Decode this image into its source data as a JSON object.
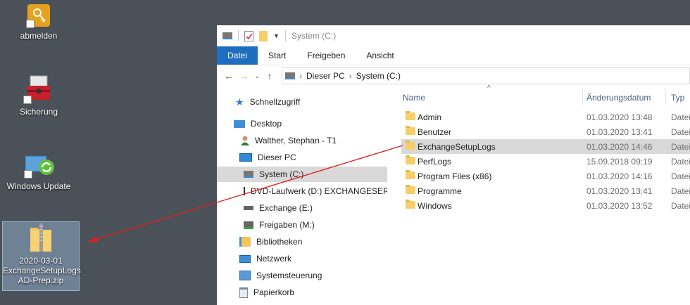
{
  "desktop": {
    "icons": [
      {
        "label": "abmelden"
      },
      {
        "label": "Sicherung"
      },
      {
        "label": "Windows Update"
      }
    ],
    "zip_file": {
      "line1": "2020-03-01",
      "line2": "ExchangeSetupLogs",
      "line3": "AD-Prep.zip"
    }
  },
  "explorer": {
    "title": "System (C:)",
    "ribbon_tabs": [
      "Datei",
      "Start",
      "Freigeben",
      "Ansicht"
    ],
    "breadcrumb": [
      "Dieser PC",
      "System (C:)"
    ],
    "nav": [
      {
        "label": "Schnellzugriff"
      },
      {
        "label": "Desktop"
      },
      {
        "label": "Walther, Stephan - T1"
      },
      {
        "label": "Dieser PC"
      },
      {
        "label": "System (C:)"
      },
      {
        "label": "DVD-Laufwerk (D:) EXCHANGESER"
      },
      {
        "label": "Exchange (E:)"
      },
      {
        "label": "Freigaben (M:)"
      },
      {
        "label": "Bibliotheken"
      },
      {
        "label": "Netzwerk"
      },
      {
        "label": "Systemsteuerung"
      },
      {
        "label": "Papierkorb"
      }
    ],
    "columns": {
      "name": "Name",
      "date": "Änderungsdatum",
      "type": "Typ"
    },
    "files": [
      {
        "name": "Admin",
        "date": "01.03.2020 13:48",
        "type": "Datei"
      },
      {
        "name": "Benutzer",
        "date": "01.03.2020 13:41",
        "type": "Datei"
      },
      {
        "name": "ExchangeSetupLogs",
        "date": "01.03.2020 14:46",
        "type": "Datei"
      },
      {
        "name": "PerfLogs",
        "date": "15.09.2018 09:19",
        "type": "Datei"
      },
      {
        "name": "Program Files (x86)",
        "date": "01.03.2020 14:16",
        "type": "Datei"
      },
      {
        "name": "Programme",
        "date": "01.03.2020 13:41",
        "type": "Datei"
      },
      {
        "name": "Windows",
        "date": "01.03.2020 13:52",
        "type": "Datei"
      }
    ]
  },
  "colors": {
    "accent": "#1e6ebf",
    "arrow": "#e02020",
    "desktop": "#4b5158"
  }
}
